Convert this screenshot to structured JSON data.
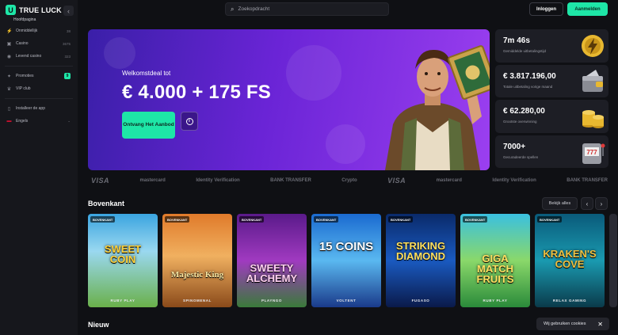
{
  "brand": {
    "name": "TRUE LUCK",
    "mark": "U"
  },
  "sidebar": {
    "home_label": "Hoofdpagina",
    "items": [
      {
        "label": "Onmiddellijk",
        "count": "38",
        "icon": "bolt-icon"
      },
      {
        "label": "Casino",
        "count": "3675",
        "icon": "slot-icon"
      },
      {
        "label": "Levend casino",
        "count": "323",
        "icon": "live-icon"
      },
      {
        "label": "Promoties",
        "badge": "9",
        "icon": "gift-icon"
      },
      {
        "label": "VIP club",
        "icon": "crown-icon"
      },
      {
        "label": "Installeer de app",
        "icon": "download-icon"
      },
      {
        "label": "Engels",
        "icon": "flag-icon"
      }
    ]
  },
  "header": {
    "search_placeholder": "Zoekopdracht",
    "login": "Inloggen",
    "signup": "Aanmelden"
  },
  "hero": {
    "subtitle": "Welkomstdeal tot",
    "title": "€ 4.000 + 175 FS",
    "cta": "Ontvang Het Aanbod"
  },
  "stats": [
    {
      "value": "7m 46s",
      "label": "Gemiddelde uitbetalingstijd"
    },
    {
      "value": "€ 3.817.196,00",
      "label": "Totale uitbetaling vorige maand"
    },
    {
      "value": "€ 62.280,00",
      "label": "Grootste overwinning"
    },
    {
      "value": "7000+",
      "label": "Gecuradeerde spellen"
    }
  ],
  "payment_logos": [
    "VISA",
    "mastercard",
    "Identity Verification",
    "BANK TRANSFER",
    "Crypto",
    "VISA",
    "mastercard",
    "Identity Verification",
    "BANK TRANSFER"
  ],
  "top_section": {
    "title": "Bovenkant",
    "see_all": "Bekijk alles"
  },
  "games": [
    {
      "tag": "BOVENKANT",
      "name": "SWEET COIN",
      "provider": "RUBY PLAY"
    },
    {
      "tag": "BOVENKANT",
      "name": "Majestic King",
      "provider": "SPINOMENAL"
    },
    {
      "tag": "BOVENKANT",
      "name": "SWEETY ALCHEMY",
      "provider": "PLAYNGO"
    },
    {
      "tag": "BOVENKANT",
      "name": "15 COINS",
      "provider": "VOLTENT"
    },
    {
      "tag": "BOVENKANT",
      "name": "STRIKING DIAMOND",
      "provider": "FUGASO"
    },
    {
      "tag": "BOVENKANT",
      "name": "GIGA MATCH FRUITS",
      "provider": "RUBY PLAY"
    },
    {
      "tag": "BOVENKANT",
      "name": "KRAKEN'S COVE",
      "provider": "RELAX GAMING"
    }
  ],
  "new_section": {
    "title": "Nieuw"
  },
  "cookie": {
    "text": "Wij gebruiken cookies"
  },
  "colors": {
    "accent": "#1ee6a7",
    "bg": "#0f1014",
    "hero_start": "#3a1fa8",
    "hero_end": "#9b3ff0"
  }
}
